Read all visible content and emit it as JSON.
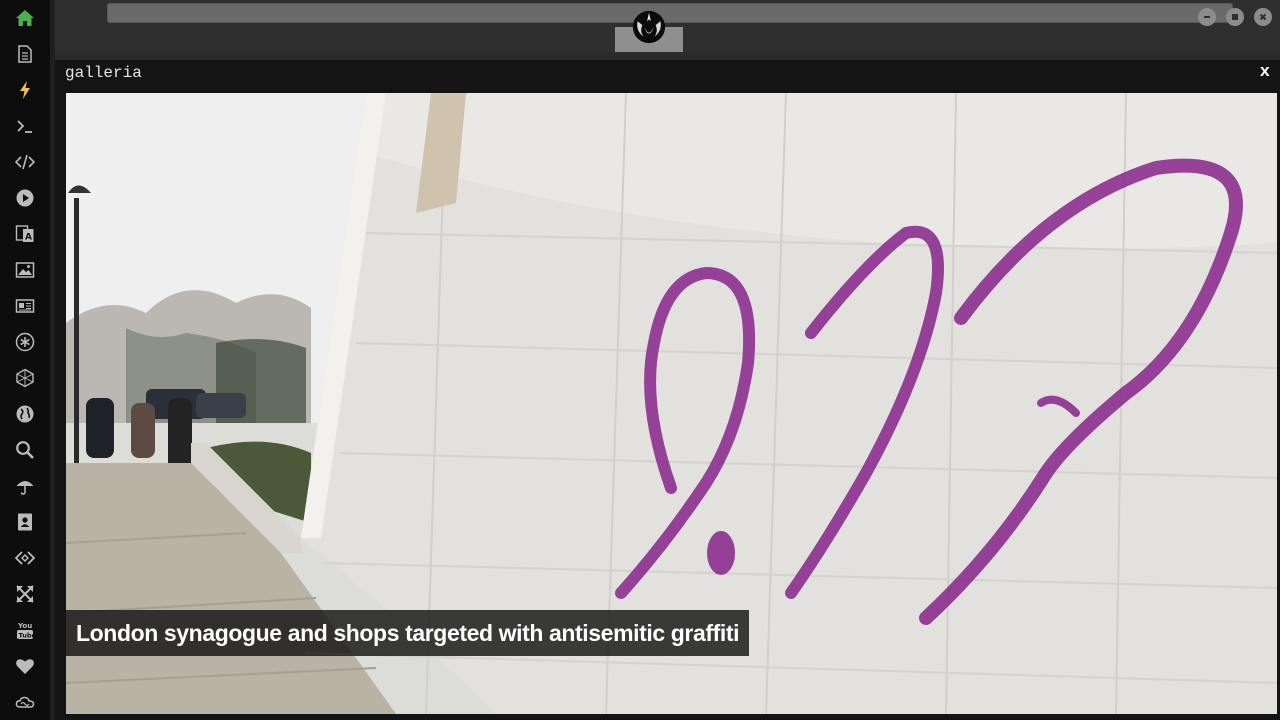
{
  "sidebar": {
    "items": [
      {
        "icon": "home-icon",
        "color": "#4caf50"
      },
      {
        "icon": "document-icon"
      },
      {
        "icon": "lightning-icon",
        "color": "#f2c14e"
      },
      {
        "icon": "terminal-icon"
      },
      {
        "icon": "code-icon"
      },
      {
        "icon": "play-icon"
      },
      {
        "icon": "translate-icon"
      },
      {
        "icon": "image-icon"
      },
      {
        "icon": "newspaper-icon"
      },
      {
        "icon": "asterisk-icon"
      },
      {
        "icon": "hexagon-icon"
      },
      {
        "icon": "globe-icon"
      },
      {
        "icon": "search-icon"
      },
      {
        "icon": "umbrella-icon"
      },
      {
        "icon": "contacts-icon"
      },
      {
        "icon": "diamond-code-icon"
      },
      {
        "icon": "expand-icon"
      },
      {
        "icon": "youtube-icon"
      },
      {
        "icon": "heart-icon"
      },
      {
        "icon": "cloud-icon"
      }
    ]
  },
  "topbar": {
    "url_value": "",
    "logo": "rebel-alliance-icon"
  },
  "window": {
    "title": "galleria",
    "close_label": "x"
  },
  "gallery": {
    "caption": "London synagogue and shops targeted with antisemitic graffiti"
  }
}
